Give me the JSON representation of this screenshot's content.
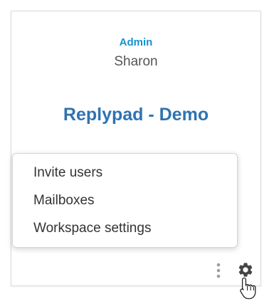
{
  "card": {
    "role": "Admin",
    "user_name": "Sharon",
    "workspace_title": "Replypad - Demo"
  },
  "menu": {
    "items": [
      {
        "label": "Invite users"
      },
      {
        "label": "Mailboxes"
      },
      {
        "label": "Workspace settings"
      }
    ]
  },
  "toolbar": {
    "icons": [
      "more-vertical-icon",
      "gear-icon"
    ]
  },
  "colors": {
    "role": "#1592d0",
    "title": "#2f73b0",
    "text": "#333333",
    "muted_icon": "#9e9e9e",
    "gear": "#444444"
  }
}
